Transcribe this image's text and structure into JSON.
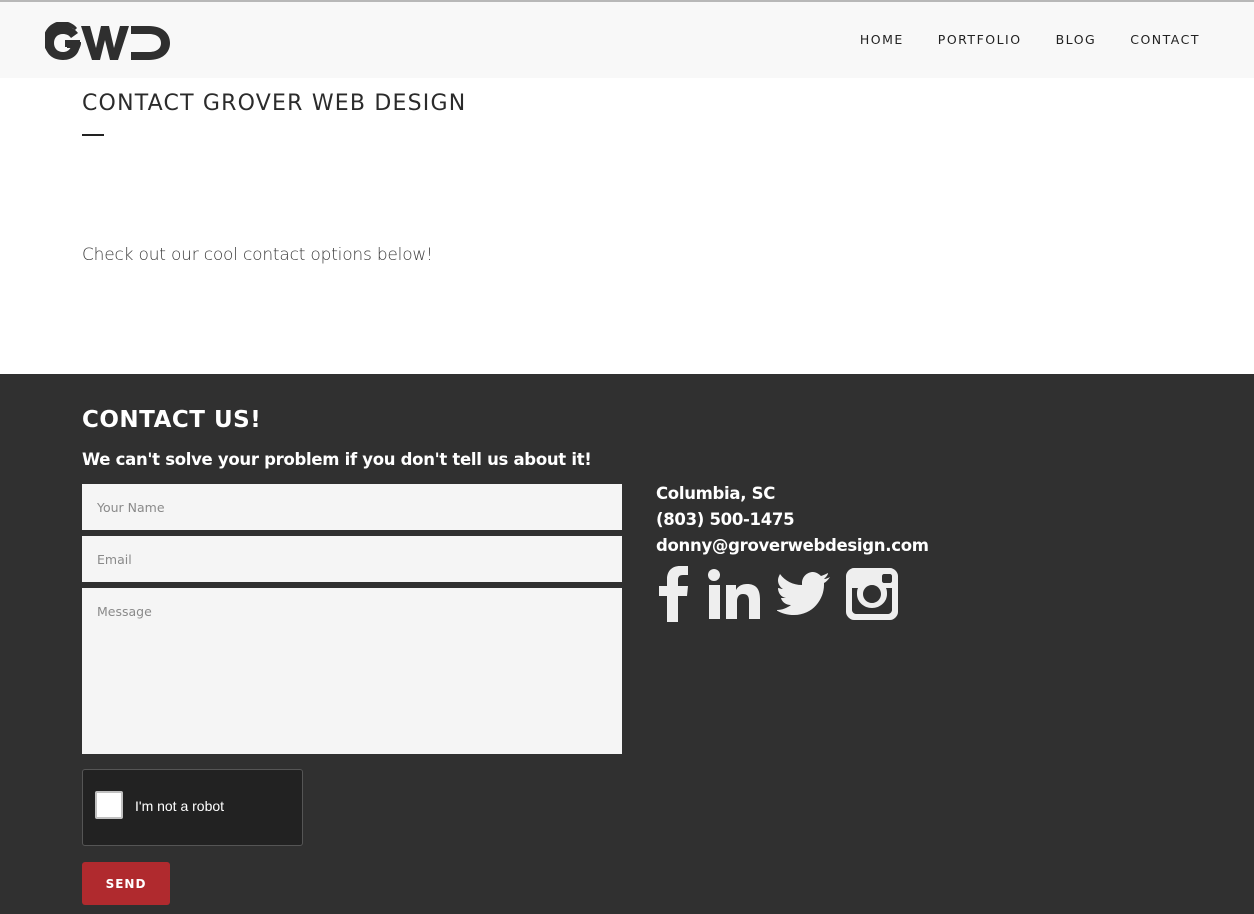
{
  "header": {
    "logo_text": "GWD",
    "nav": [
      {
        "label": "HOME"
      },
      {
        "label": "PORTFOLIO"
      },
      {
        "label": "BLOG"
      },
      {
        "label": "CONTACT"
      }
    ]
  },
  "main": {
    "title": "CONTACT GROVER WEB DESIGN",
    "intro": "Check out our cool contact options below!"
  },
  "footer": {
    "heading": "CONTACT US!",
    "subheading": "We can't solve your problem if you don't tell us about it!",
    "form": {
      "name_placeholder": "Your Name",
      "email_placeholder": "Email",
      "message_placeholder": "Message",
      "name_value": "",
      "email_value": "",
      "message_value": "",
      "recaptcha_label": "I'm not a robot",
      "send_label": "SEND"
    },
    "info": {
      "location": "Columbia, SC",
      "phone": "(803) 500-1475",
      "email": "donny@groverwebdesign.com"
    },
    "social": [
      {
        "icon": "facebook-icon"
      },
      {
        "icon": "linkedin-icon"
      },
      {
        "icon": "twitter-icon"
      },
      {
        "icon": "instagram-icon"
      }
    ],
    "colors": {
      "background": "#303030",
      "accent": "#b02a2e"
    }
  }
}
